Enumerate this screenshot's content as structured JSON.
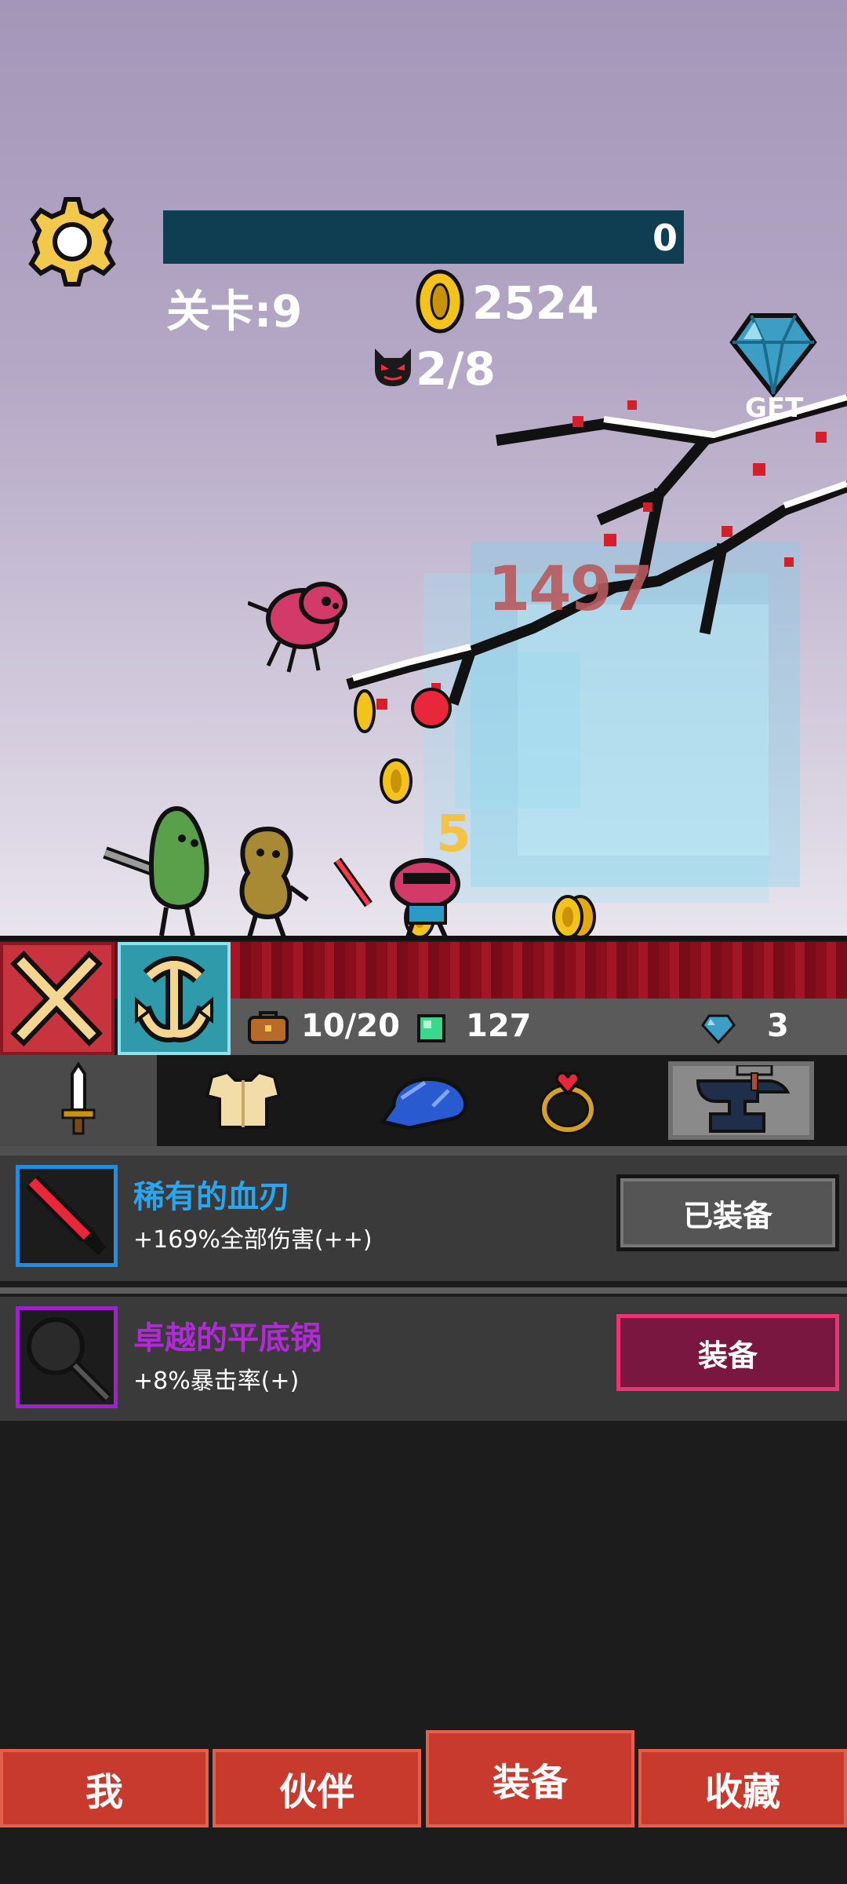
{
  "hud": {
    "progress_value": "0",
    "stage": "关卡:9",
    "gold": "2524",
    "enemy_count": "2/8",
    "gem_get_label": "GET"
  },
  "battle": {
    "damage_number": "1497",
    "hit_number": "5"
  },
  "resources": {
    "bag": "10/20",
    "cubes": "127",
    "diamonds": "3"
  },
  "categories": [
    {
      "icon": "sword-icon",
      "active": true
    },
    {
      "icon": "armor-icon",
      "active": false
    },
    {
      "icon": "cap-icon",
      "active": false
    },
    {
      "icon": "ring-icon",
      "active": false
    },
    {
      "icon": "anvil-icon",
      "active": false
    }
  ],
  "items": [
    {
      "name": "稀有的血刃",
      "desc": "+169%全部伤害(++)",
      "button": "已装备",
      "rarity_color": "#2aa5ef",
      "icon": "blood-blade-icon"
    },
    {
      "name": "卓越的平底锅",
      "desc": "+8%暴击率(+)",
      "button": "装备",
      "rarity_color": "#b22ad8",
      "icon": "frying-pan-icon"
    }
  ],
  "nav": {
    "me": "我",
    "partner": "伙伴",
    "equipment": "装备",
    "collection": "收藏"
  },
  "colors": {
    "accent_red": "#c83a2e",
    "progress_bg": "#0f3d52",
    "rare_blue": "#2aa5ef",
    "epic_purple": "#b22ad8"
  }
}
